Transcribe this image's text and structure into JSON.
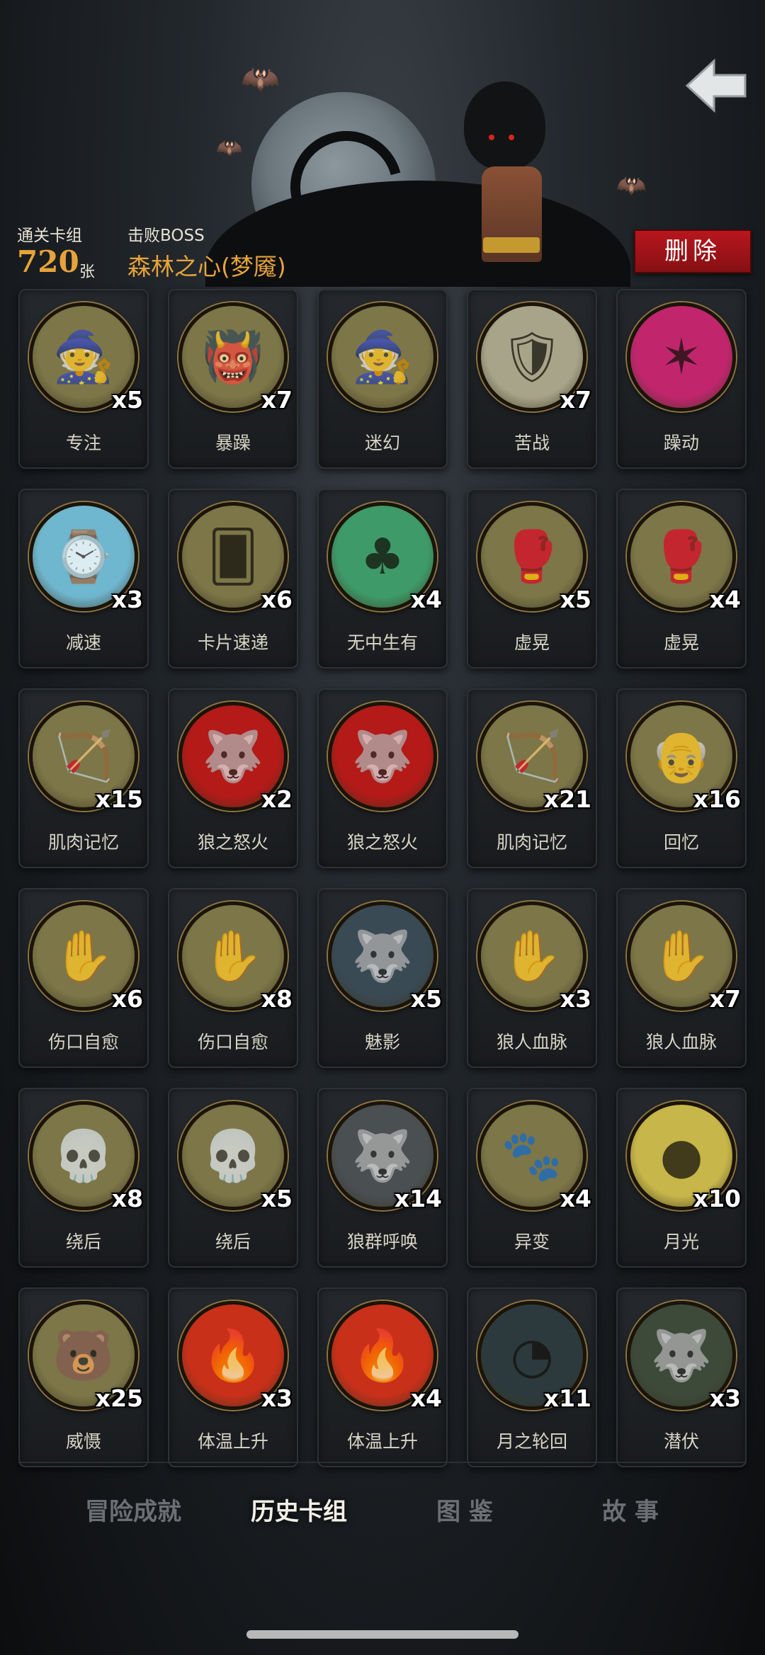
{
  "header": {
    "clear_deck_label": "通关卡组",
    "clear_count": "720",
    "clear_unit": "张",
    "defeat_boss_label": "击败BOSS",
    "boss_name": "森林之心(梦魇)",
    "delete_label": "删除",
    "back_icon": "back-arrow-icon"
  },
  "colors": {
    "accent_orange": "#e6a33a",
    "delete_red": "#b8161d",
    "card_art_bg": "#7a7244"
  },
  "cards": [
    {
      "name": "专注",
      "count": "x5",
      "art": "wizard-icon",
      "bg": "#7d7648"
    },
    {
      "name": "暴躁",
      "count": "x7",
      "art": "ogre-icon",
      "bg": "#7d7648"
    },
    {
      "name": "迷幻",
      "count": "",
      "art": "witch-icon",
      "bg": "#7d7648"
    },
    {
      "name": "苦战",
      "count": "x7",
      "art": "warrior-icon",
      "bg": "#a8a489"
    },
    {
      "name": "躁动",
      "count": "",
      "art": "demon-burst-icon",
      "bg": "#c1266d"
    },
    {
      "name": "减速",
      "count": "x3",
      "art": "pocket-watch-icon",
      "bg": "#6fb6cf"
    },
    {
      "name": "卡片速递",
      "count": "x6",
      "art": "card-fly-icon",
      "bg": "#7d7648"
    },
    {
      "name": "无中生有",
      "count": "x4",
      "art": "plant-sign-icon",
      "bg": "#3e9a69"
    },
    {
      "name": "虚晃",
      "count": "x5",
      "art": "boxer-icon",
      "bg": "#7d7648"
    },
    {
      "name": "虚晃",
      "count": "x4",
      "art": "boxer-icon",
      "bg": "#7d7648"
    },
    {
      "name": "肌肉记忆",
      "count": "x15",
      "art": "hunter-icon",
      "bg": "#7d7648"
    },
    {
      "name": "狼之怒火",
      "count": "x2",
      "art": "werewolf-rage-icon",
      "bg": "#b31a18"
    },
    {
      "name": "狼之怒火",
      "count": "",
      "art": "werewolf-rage-icon",
      "bg": "#b31a18"
    },
    {
      "name": "肌肉记忆",
      "count": "x21",
      "art": "hunter-icon",
      "bg": "#7d7648"
    },
    {
      "name": "回忆",
      "count": "x16",
      "art": "old-man-icon",
      "bg": "#7d7648"
    },
    {
      "name": "伤口自愈",
      "count": "x6",
      "art": "wounded-boy-icon",
      "bg": "#7d7648"
    },
    {
      "name": "伤口自愈",
      "count": "x8",
      "art": "wounded-boy-icon",
      "bg": "#7d7648"
    },
    {
      "name": "魅影",
      "count": "x5",
      "art": "phantom-wolf-icon",
      "bg": "#3a4a55"
    },
    {
      "name": "狼人血脉",
      "count": "x3",
      "art": "clawed-hand-icon",
      "bg": "#7d7648"
    },
    {
      "name": "狼人血脉",
      "count": "x7",
      "art": "clawed-hand-icon",
      "bg": "#7d7648"
    },
    {
      "name": "绕后",
      "count": "x8",
      "art": "skeleton-icon",
      "bg": "#7d7648"
    },
    {
      "name": "绕后",
      "count": "x5",
      "art": "skeleton-icon",
      "bg": "#7d7648"
    },
    {
      "name": "狼群呼唤",
      "count": "x14",
      "art": "wolf-howl-icon",
      "bg": "#4a4f52"
    },
    {
      "name": "异变",
      "count": "x4",
      "art": "mutation-icon",
      "bg": "#7d7648"
    },
    {
      "name": "月光",
      "count": "x10",
      "art": "full-moon-icon",
      "bg": "#c7b64a"
    },
    {
      "name": "威慑",
      "count": "x25",
      "art": "bear-icon",
      "bg": "#7d7648"
    },
    {
      "name": "体温上升",
      "count": "x3",
      "art": "fire-wolf-icon",
      "bg": "#c8301a"
    },
    {
      "name": "体温上升",
      "count": "x4",
      "art": "fire-wolf-icon",
      "bg": "#c8301a"
    },
    {
      "name": "月之轮回",
      "count": "x11",
      "art": "moon-phases-icon",
      "bg": "#2c3a3e"
    },
    {
      "name": "潜伏",
      "count": "x3",
      "art": "lurking-wolf-icon",
      "bg": "#3d4a3a"
    }
  ],
  "nav": {
    "tabs": [
      "冒险成就",
      "历史卡组",
      "图 鉴",
      "故 事"
    ],
    "active": "历史卡组"
  }
}
